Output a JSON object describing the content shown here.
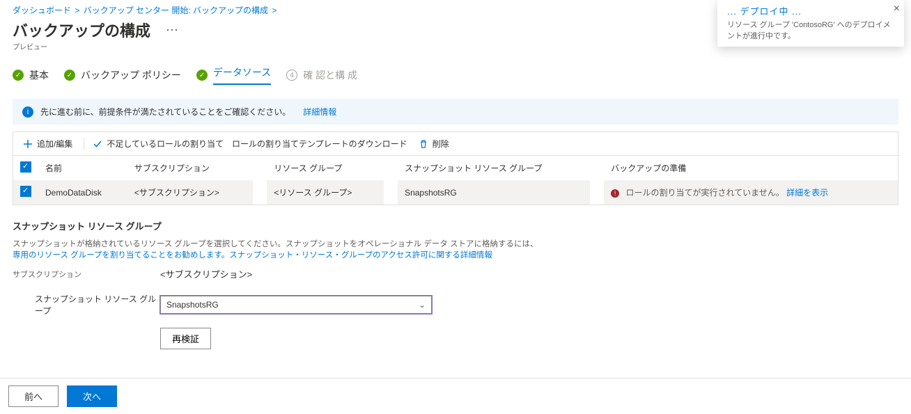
{
  "breadcrumb": {
    "items": [
      "ダッシュボード",
      "バックアップ センター 開始: バックアップの構成"
    ]
  },
  "page": {
    "title": "バックアップの構成",
    "preview": "プレビュー",
    "more": "⋯"
  },
  "steps": {
    "s1": "基本",
    "s2": "バックアップ ポリシー",
    "s3": "データソース",
    "s4_num": "4",
    "s4": "確 認と構 成"
  },
  "info": {
    "text": "先に進む前に、前提条件が満たされていることをご確認ください。",
    "link": "詳細情報"
  },
  "toolbar": {
    "add_edit": "追加/編集",
    "assign_missing": "不足しているロールの割り当て",
    "download_template": "ロールの割り当てテンプレートのダウンロード",
    "delete": "削除"
  },
  "table": {
    "headers": {
      "name": "名前",
      "subscription": "サブスクリプション",
      "rg": "リソース グループ",
      "snapshot_rg": "スナップショット リソース グループ",
      "backup_ready": "バックアップの準備"
    },
    "row": {
      "name": "DemoDataDisk",
      "subscription": "<サブスクリプション>",
      "rg": "<リソース グループ>",
      "snapshot_rg": "SnapshotsRG",
      "status": "ロールの割り当てが実行されていません。",
      "detail": "詳細を表示"
    }
  },
  "snapshot_section": {
    "heading": "スナップショット リソース グループ",
    "help_line1": "スナップショットが格納されているリソース グループを選択してください。スナップショットをオペレーショナル データ ストアに格納するには、",
    "help_link": "専用のリソース グループを割り当てることをお勧めします。スナップショット・リソース・グループのアクセス許可に関する詳細情報",
    "subscription_label": "サブスクリプション",
    "subscription_value": "<サブスクリプション>",
    "snapshot_rg_label": "スナップショット リソース グループ",
    "snapshot_rg_value": "SnapshotsRG",
    "revalidate": "再検証"
  },
  "footer": {
    "prev": "前へ",
    "next": "次へ"
  },
  "notification": {
    "title": "... デプロイ中 ...",
    "body": "リソース グループ 'ContosoRG' へのデプロイメントが進行中です。"
  }
}
